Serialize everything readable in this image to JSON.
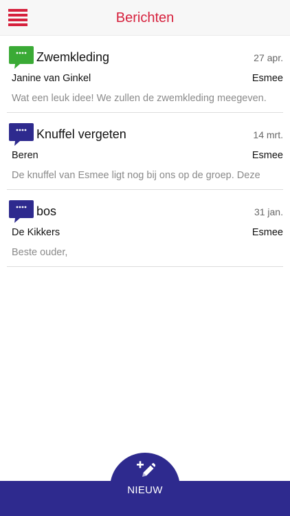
{
  "header": {
    "title": "Berichten",
    "menu_icon": "hamburger-menu-icon",
    "accent_color": "#d6203c"
  },
  "messages": [
    {
      "subject": "Zwemkleding",
      "date": "27 apr.",
      "from": "Janine van Ginkel",
      "to": "Esmee",
      "preview": "Wat een leuk idee! We zullen de zwemkleding meegeven.",
      "icon": "chat-bubble-icon",
      "icon_color": "#3aaa35"
    },
    {
      "subject": "Knuffel vergeten",
      "date": "14 mrt.",
      "from": "Beren",
      "to": "Esmee",
      "preview": "De knuffel van Esmee ligt nog bij ons op de groep. Deze",
      "icon": "chat-bubble-icon",
      "icon_color": "#2e2a8e"
    },
    {
      "subject": "bos",
      "date": "31 jan.",
      "from": "De Kikkers",
      "to": "Esmee",
      "preview": "Beste ouder,",
      "icon": "chat-bubble-icon",
      "icon_color": "#2e2a8e"
    }
  ],
  "footer": {
    "new_label": "NIEUW",
    "new_icon": "compose-pencil-icon",
    "bar_color": "#2e2a8e"
  }
}
